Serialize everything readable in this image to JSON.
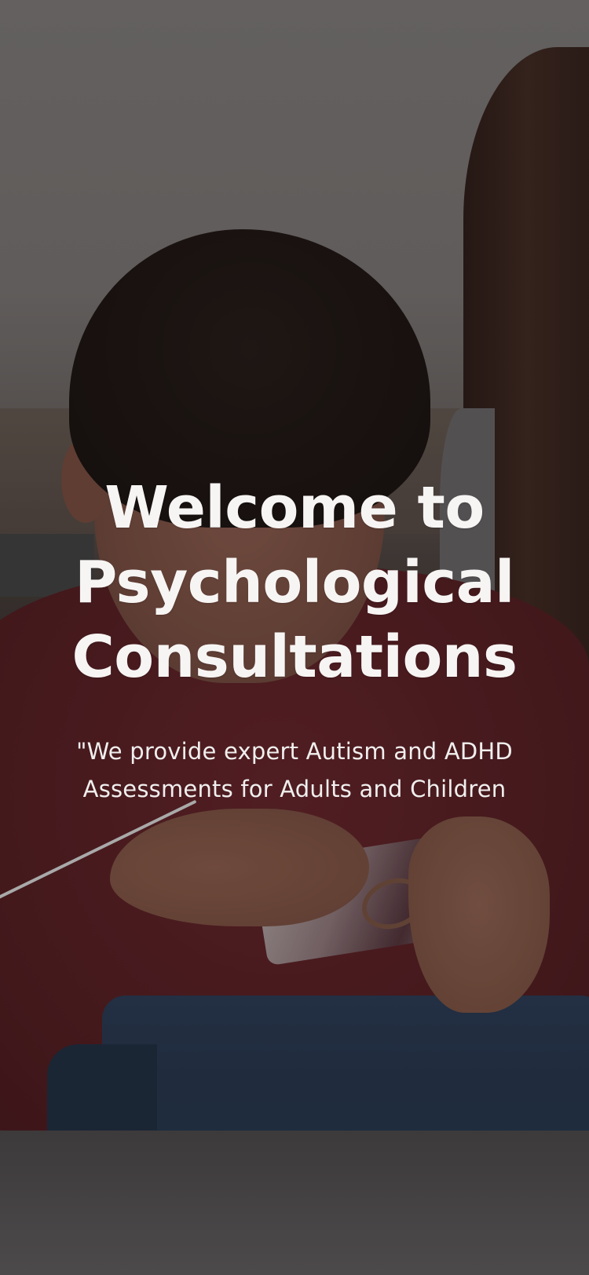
{
  "hero": {
    "title": "Welcome to Psychological Consultations",
    "subtitle": "\"We provide expert Autism and ADHD Assessments for Adults and Children"
  }
}
